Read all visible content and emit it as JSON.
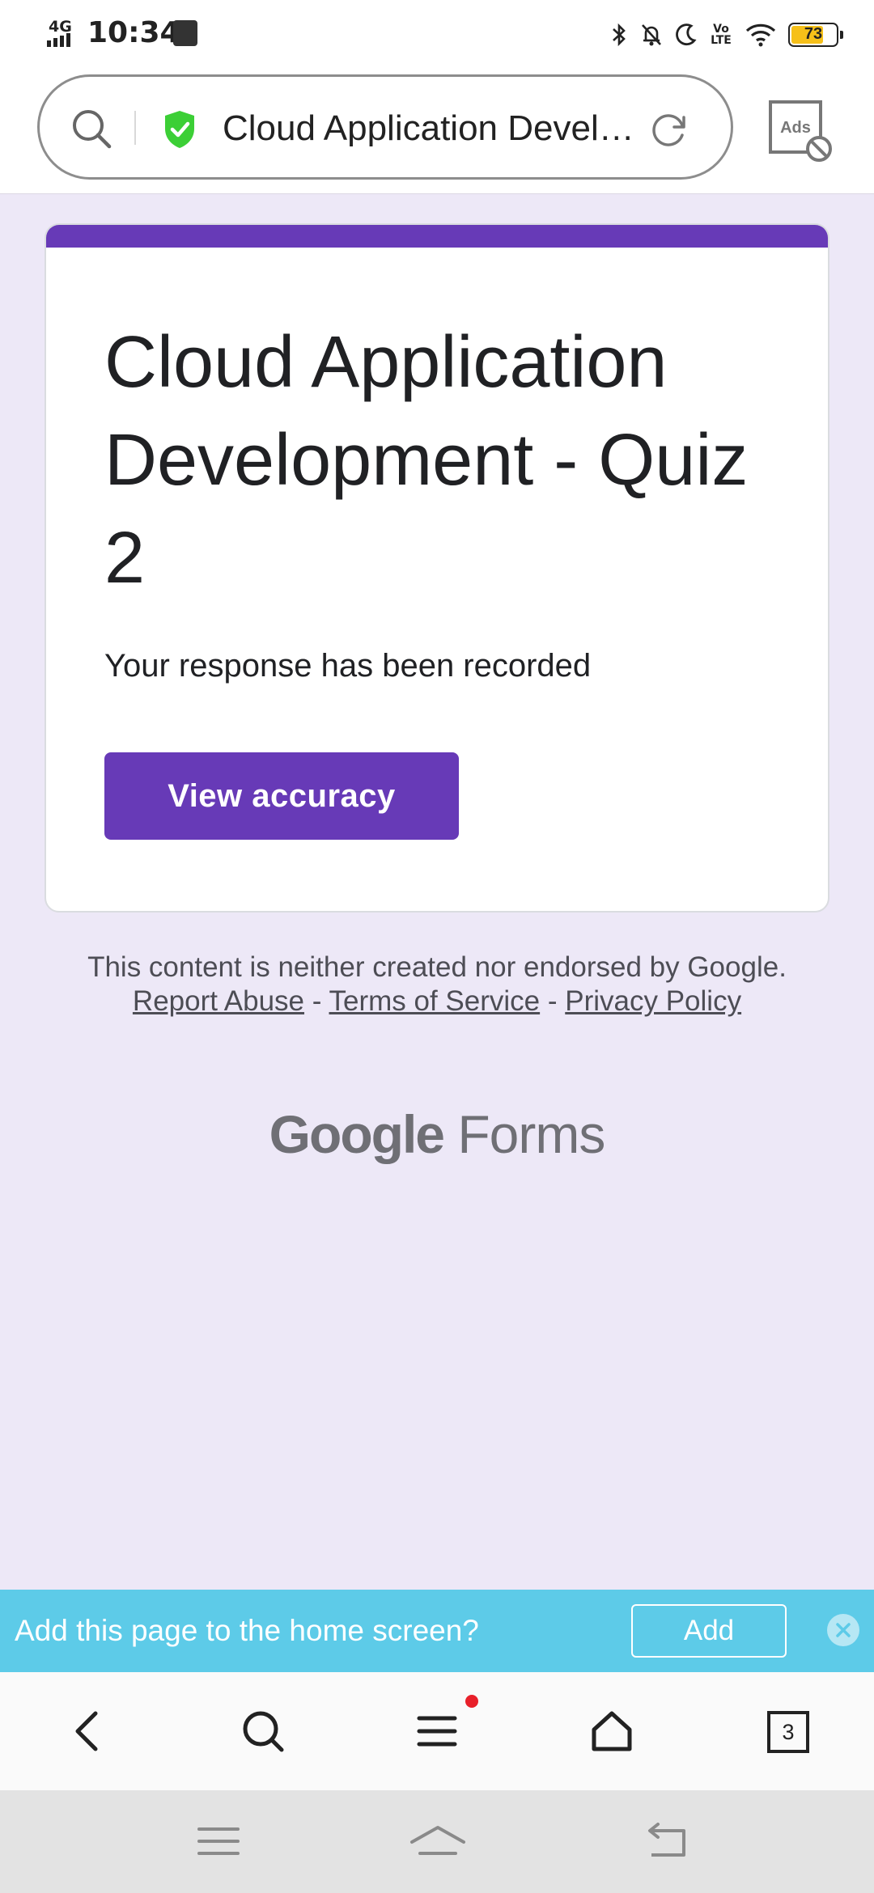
{
  "status_bar": {
    "network": "4G",
    "time": "10:34",
    "volte": "Vo LTE",
    "battery": "73"
  },
  "browser": {
    "url_title": "Cloud Application Devel…",
    "ads_label": "Ads",
    "shield_color": "#3ccf36"
  },
  "form": {
    "title": "Cloud Application Development - Quiz 2",
    "response_text": "Your response has been recorded",
    "view_button": "View accuracy",
    "accent_color": "#673ab7"
  },
  "footer": {
    "disclaimer_prefix": "This content is neither created nor endorsed by Google.",
    "report_abuse": "Report Abuse",
    "sep": "-",
    "terms": "Terms of Service",
    "privacy": "Privacy Policy",
    "brand_google": "Google",
    "brand_forms": "Forms"
  },
  "banner": {
    "text": "Add this page to the home screen?",
    "add_button": "Add"
  },
  "toolbar": {
    "tabs_count": "3"
  },
  "icons": {
    "status": [
      "signal-icon",
      "shopping-bag-icon",
      "bluetooth-icon",
      "mute-icon",
      "moon-icon",
      "wifi-icon",
      "battery-icon"
    ],
    "browser": [
      "search-icon",
      "shield-check-icon",
      "reload-icon",
      "ads-block-icon"
    ],
    "toolbar": [
      "back-icon",
      "search-icon",
      "menu-icon",
      "home-icon",
      "tabs-icon"
    ],
    "system": [
      "recent-apps-icon",
      "home-icon",
      "back-icon"
    ]
  }
}
